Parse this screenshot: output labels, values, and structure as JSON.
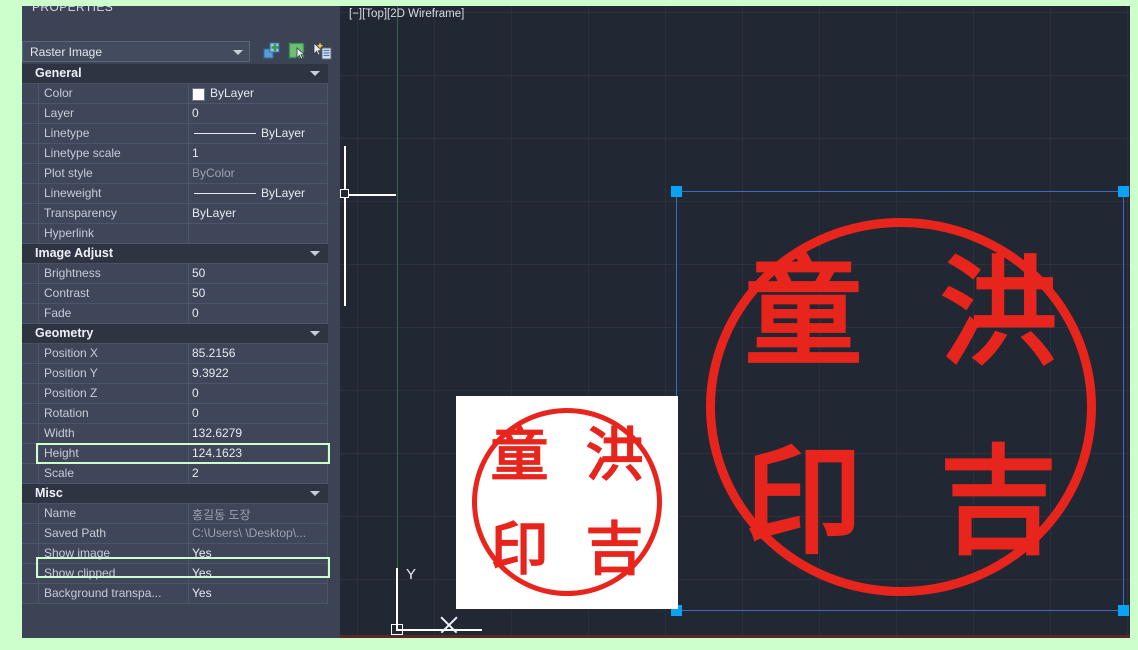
{
  "window": {
    "accent_green": "#ccffcc",
    "panel_bg": "#3c4354",
    "viewport_bg": "#212733",
    "seal_red": "#e8251c",
    "grip_blue": "#0aa2f7",
    "selection_blue": "#3f6bbf"
  },
  "palette": {
    "title": "PROPERTIES",
    "object_type": "Raster Image",
    "dropdown_arrow": "chevron-down-icon",
    "toolbar": [
      {
        "name": "select-objects-icon",
        "tip": "Select Objects"
      },
      {
        "name": "toggle-pickadd-icon",
        "tip": "Toggle value of PICKADD system variable"
      },
      {
        "name": "quick-select-icon",
        "tip": "Quick Select"
      }
    ],
    "sections": [
      {
        "label": "General",
        "collapsed": false,
        "rows": [
          {
            "name": "Color",
            "value": "ByLayer",
            "swatch": "color-chip",
            "dim": false
          },
          {
            "name": "Layer",
            "value": "0",
            "dim": false
          },
          {
            "name": "Linetype",
            "value": "ByLayer",
            "swatch": "line",
            "dim": false
          },
          {
            "name": "Linetype scale",
            "value": "1",
            "dim": false
          },
          {
            "name": "Plot style",
            "value": "ByColor",
            "dim": true
          },
          {
            "name": "Lineweight",
            "value": "ByLayer",
            "swatch": "line",
            "dim": false
          },
          {
            "name": "Transparency",
            "value": "ByLayer",
            "dim": false
          },
          {
            "name": "Hyperlink",
            "value": "",
            "dim": false
          }
        ]
      },
      {
        "label": "Image Adjust",
        "collapsed": false,
        "rows": [
          {
            "name": "Brightness",
            "value": "50",
            "dim": false
          },
          {
            "name": "Contrast",
            "value": "50",
            "dim": false
          },
          {
            "name": "Fade",
            "value": "0",
            "dim": false
          }
        ]
      },
      {
        "label": "Geometry",
        "collapsed": false,
        "rows": [
          {
            "name": "Position X",
            "value": "85.2156",
            "dim": false
          },
          {
            "name": "Position Y",
            "value": "9.3922",
            "dim": false
          },
          {
            "name": "Position Z",
            "value": "0",
            "dim": false
          },
          {
            "name": "Rotation",
            "value": "0",
            "dim": false
          },
          {
            "name": "Width",
            "value": "132.6279",
            "dim": false
          },
          {
            "name": "Height",
            "value": "124.1623",
            "dim": false
          },
          {
            "name": "Scale",
            "value": "2",
            "dim": false,
            "highlighted": true
          }
        ]
      },
      {
        "label": "Misc",
        "collapsed": false,
        "rows": [
          {
            "name": "Name",
            "value": "홍길동 도장",
            "dim": true
          },
          {
            "name": "Saved Path",
            "value": "C:\\Users\\     \\Desktop\\...",
            "dim": true
          },
          {
            "name": "Show image",
            "value": "Yes",
            "dim": false
          },
          {
            "name": "Show clipped",
            "value": "Yes",
            "dim": false
          },
          {
            "name": "Background  transpa...",
            "value": "Yes",
            "dim": false,
            "highlighted": true
          }
        ]
      }
    ]
  },
  "viewport": {
    "label": "[−][Top][2D Wireframe]",
    "ucs_y_label": "Y",
    "cursor": "crosshair-x-icon",
    "objects": {
      "selected_image": {
        "name": "raster-image-seal-large",
        "background_transparent": true,
        "seal_characters": [
          "童",
          "洪",
          "印",
          "吉"
        ],
        "grips": 4
      },
      "thumbnail_image": {
        "name": "raster-image-seal-thumbnail",
        "background_transparent": false,
        "seal_characters": [
          "童",
          "洪",
          "印",
          "吉"
        ]
      }
    }
  }
}
